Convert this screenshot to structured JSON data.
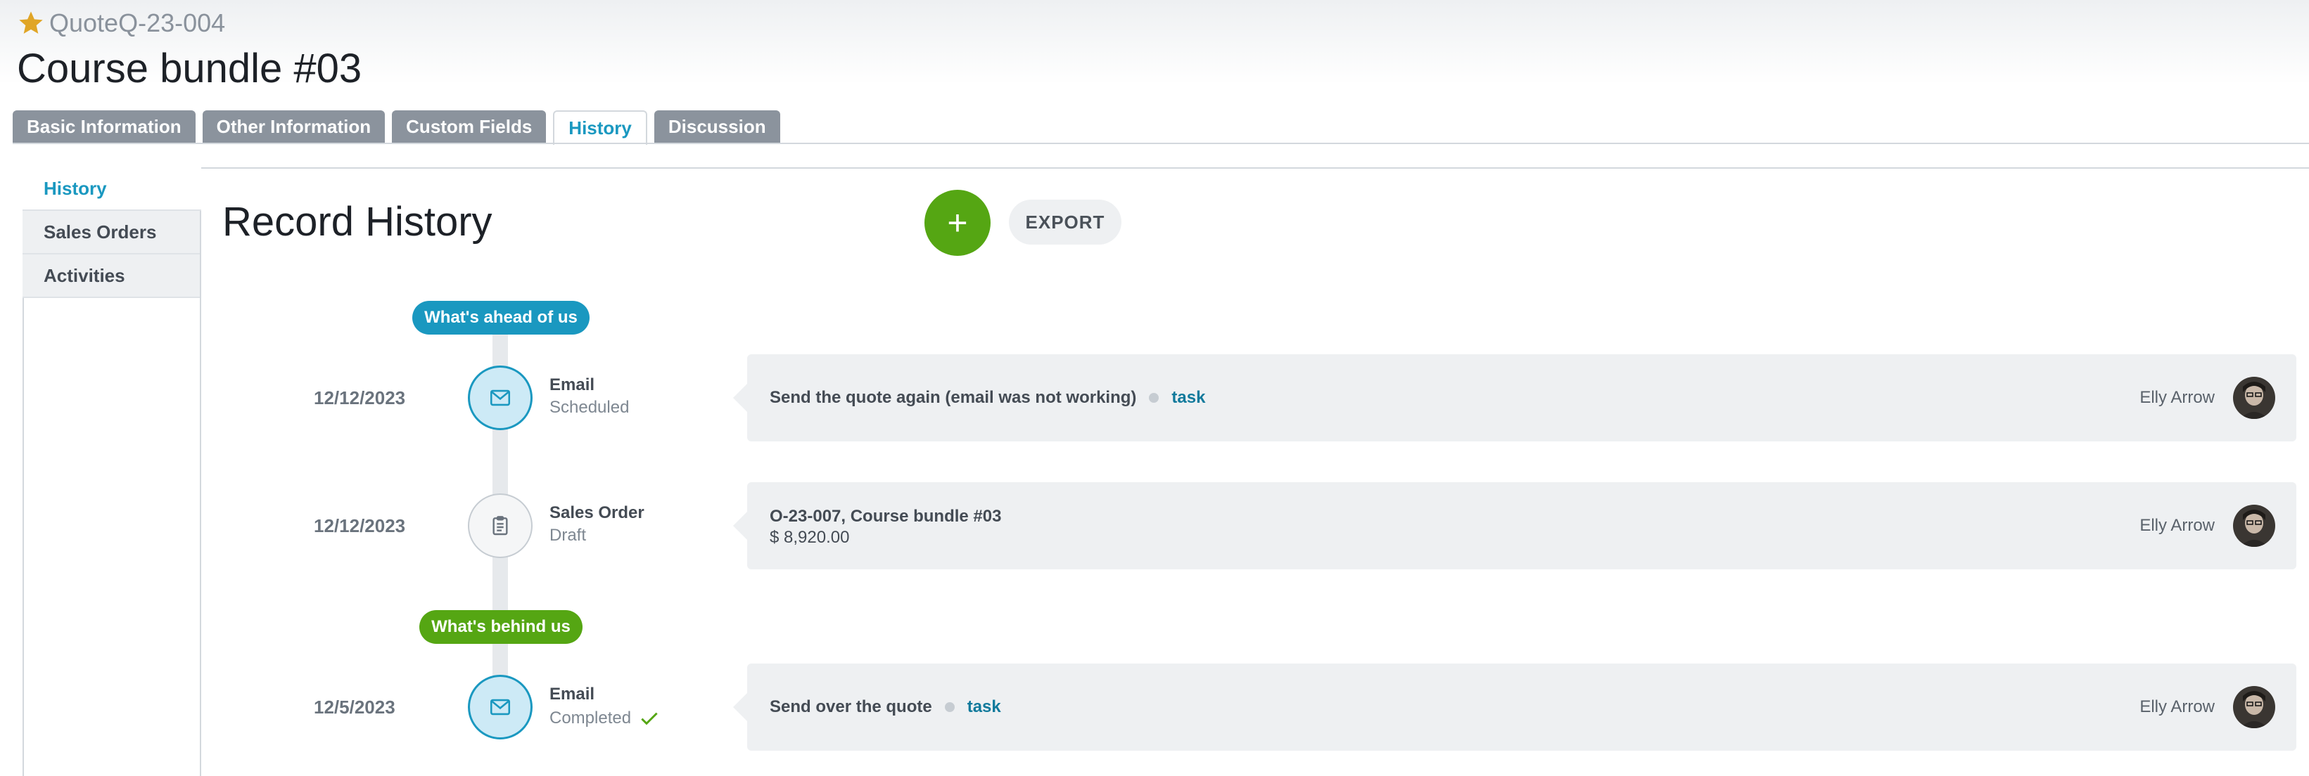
{
  "header": {
    "record_type": "Quote",
    "record_number": "Q-23-004",
    "title": "Course bundle #03"
  },
  "tabs": [
    {
      "label": "Basic Information",
      "active": false
    },
    {
      "label": "Other Information",
      "active": false
    },
    {
      "label": "Custom Fields",
      "active": false
    },
    {
      "label": "History",
      "active": true
    },
    {
      "label": "Discussion",
      "active": false
    }
  ],
  "side_nav": [
    {
      "label": "History",
      "active": true
    },
    {
      "label": "Sales Orders",
      "active": false
    },
    {
      "label": "Activities",
      "active": false
    }
  ],
  "main": {
    "title": "Record History",
    "add_label": "+",
    "export_label": "EXPORT"
  },
  "timeline": {
    "ahead_label": "What's ahead of us",
    "behind_label": "What's behind us",
    "entries": [
      {
        "date": "12/12/2023",
        "type": "Email",
        "status": "Scheduled",
        "icon": "mail-icon",
        "summary": "Send the quote again (email was not working)",
        "tag": "task",
        "user": "Elly Arrow"
      },
      {
        "date": "12/12/2023",
        "type": "Sales Order",
        "status": "Draft",
        "icon": "clipboard-icon",
        "summary": "O-23-007, Course bundle #03",
        "amount": "$ 8,920.00",
        "user": "Elly Arrow"
      },
      {
        "date": "12/5/2023",
        "type": "Email",
        "status": "Completed",
        "icon": "mail-icon",
        "summary": "Send over the quote",
        "tag": "task",
        "user": "Elly Arrow"
      }
    ]
  },
  "colors": {
    "accent_blue": "#1a98c0",
    "accent_green": "#55a613",
    "card_bg": "#eef0f2",
    "star": "#e0a526"
  }
}
